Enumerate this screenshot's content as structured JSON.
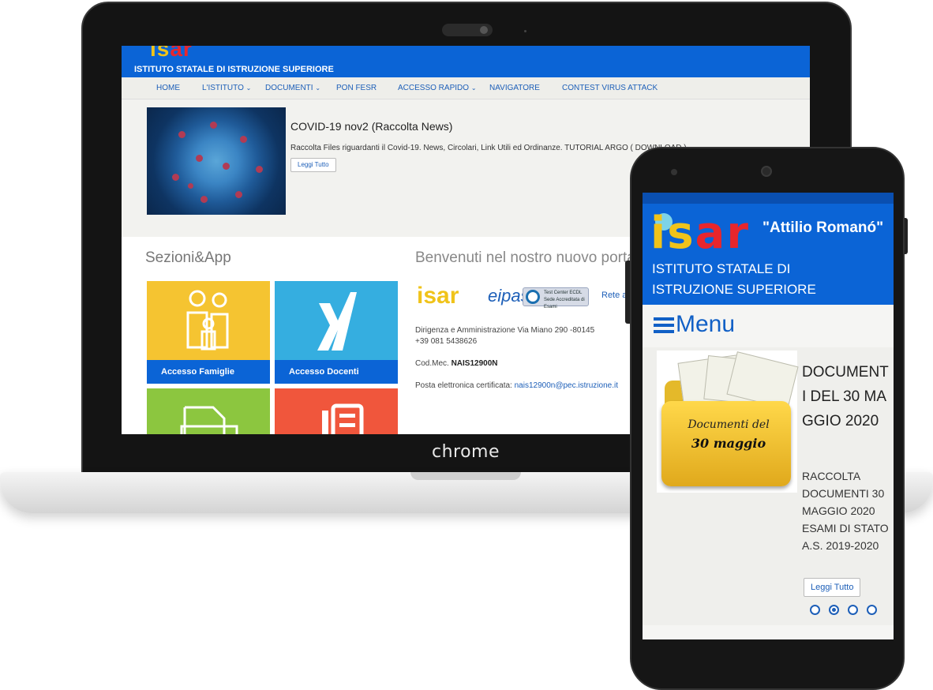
{
  "laptop": {
    "brand": "chrome",
    "site": {
      "logo": {
        "part1": "is",
        "part2": "ar"
      },
      "subtitle": "ISTITUTO STATALE DI ISTRUZIONE SUPERIORE",
      "nav": [
        {
          "label": "HOME",
          "has_dropdown": false
        },
        {
          "label": "L'ISTITUTO",
          "has_dropdown": true
        },
        {
          "label": "DOCUMENTI",
          "has_dropdown": true
        },
        {
          "label": "PON FESR",
          "has_dropdown": false
        },
        {
          "label": "ACCESSO RAPIDO",
          "has_dropdown": true
        },
        {
          "label": "NAVIGATORE",
          "has_dropdown": false
        },
        {
          "label": "CONTEST VIRUS ATTACK",
          "has_dropdown": false
        }
      ],
      "feature": {
        "title": "COVID-19 nov2 (Raccolta News)",
        "text": "Raccolta Files riguardanti il Covid-19. News, Circolari, Link Utili ed Ordinanze.    TUTORIAL ARGO ( DOWNLOAD )",
        "button": "Leggi Tutto"
      },
      "sections_title": "Sezioni&App",
      "tiles": [
        {
          "label": "Accesso Famiglie",
          "color": "#f5c431"
        },
        {
          "label": "Accesso Docenti",
          "color": "#35aee0"
        },
        {
          "label": "",
          "color": "#8cc63f"
        },
        {
          "label": "",
          "color": "#f0563c"
        }
      ],
      "welcome_title": "Benvenuti nel nostro nuovo portale",
      "logos": {
        "isar": "isar",
        "eipass": "eipass",
        "ecdl": "Test Center ECDL Sede Accreditata di Esami",
        "rete": "Rete a"
      },
      "address": "Dirigenza e Amministrazione Via Miano 290 -80145",
      "phone": "+39 081 5438626",
      "codmec_label": "Cod.Mec.",
      "codmec_value": "NAIS12900N",
      "pec_label": "Posta elettronica certificata:",
      "pec_value": "nais12900n@pec.istruzione.it"
    }
  },
  "phone": {
    "logo": {
      "part1": "is",
      "part2": "ar"
    },
    "motto": "\"Attilio Romanó\"",
    "subtitle": "ISTITUTO STATALE DI ISTRUZIONE SUPERIORE",
    "menu_label": "Menu",
    "card": {
      "image_text_line1": "Documenti del",
      "image_text_line2": "30 maggio",
      "title": "DOCUMENTI DEL 30 MAGGIO 2020",
      "text": "RACCOLTA DOCUMENTI 30 MAGGIO 2020 ESAMI DI STATO A.S. 2019-2020",
      "button": "Leggi Tutto"
    },
    "carousel": {
      "count": 4,
      "active_index": 1
    }
  }
}
